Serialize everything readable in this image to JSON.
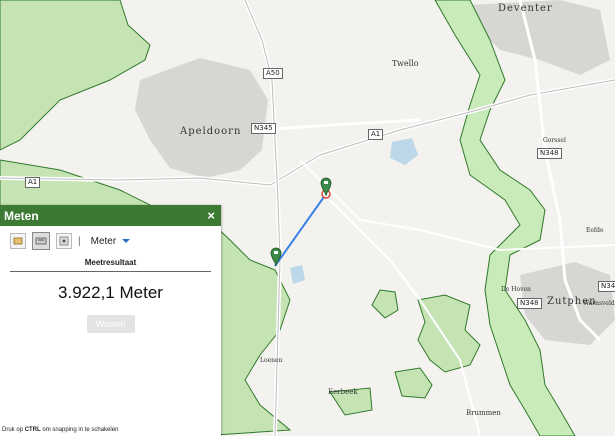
{
  "map": {
    "places": [
      {
        "name": "Deventer",
        "icon": "place-label"
      },
      {
        "name": "Twello",
        "icon": "place-label"
      },
      {
        "name": "Apeldoorn",
        "icon": "place-label"
      },
      {
        "name": "Gorssel",
        "icon": "place-label"
      },
      {
        "name": "Eefde",
        "icon": "place-label"
      },
      {
        "name": "De Hoven",
        "icon": "place-label"
      },
      {
        "name": "Zutphen",
        "icon": "place-label"
      },
      {
        "name": "Warnsveld",
        "icon": "place-label"
      },
      {
        "name": "Loenen",
        "icon": "place-label"
      },
      {
        "name": "Eerbeek",
        "icon": "place-label"
      },
      {
        "name": "Brummen",
        "icon": "place-label"
      }
    ],
    "roads": [
      "A50",
      "N345",
      "A1",
      "A1",
      "N348",
      "N348",
      "N34",
      "N345"
    ],
    "colors": {
      "nature": "#c5e3b3",
      "nature_outline": "#2f7a2b",
      "river": "#c9eab9",
      "urban": "#d8d6d3",
      "road": "#ffffff",
      "measure_line": "#3b82e8",
      "marker": "#3c8a4a"
    }
  },
  "panel": {
    "title": "Meten",
    "close_icon": "×",
    "tools": [
      "area-tool-icon",
      "distance-tool-icon",
      "location-tool-icon"
    ],
    "unit": "Meter",
    "result_title": "Meetresultaat",
    "result_value": "3.922,1 Meter",
    "clear_label": "Wissen"
  },
  "footer": {
    "hint_prefix": "Druk op ",
    "hint_key": "CTRL",
    "hint_suffix": " om snapping in te schakelen"
  }
}
